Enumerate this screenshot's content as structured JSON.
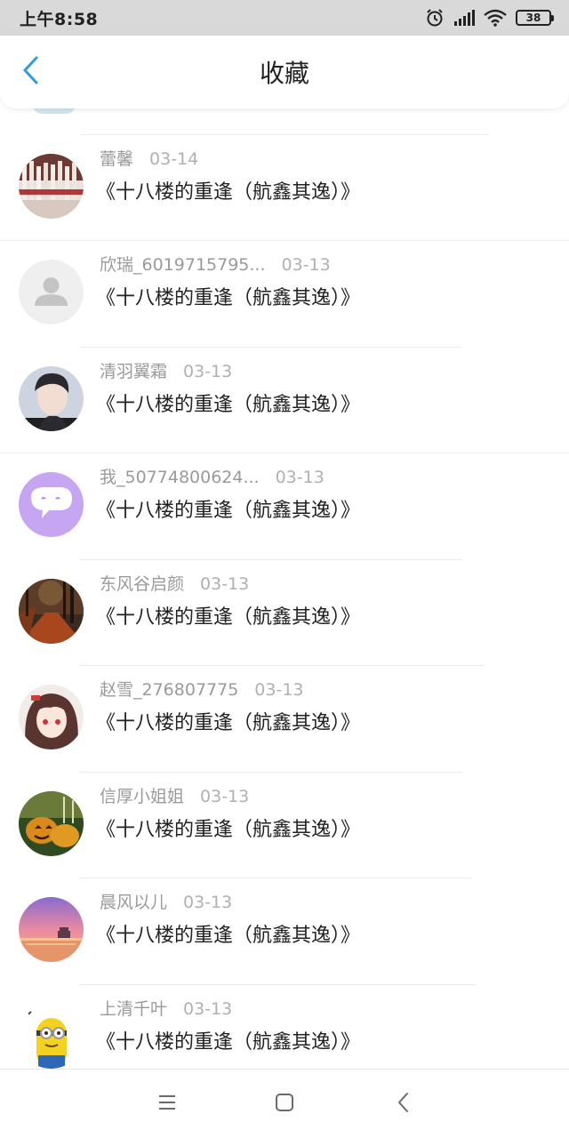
{
  "status_bar": {
    "time": "上午8:58",
    "battery": "38",
    "icons": [
      "alarm-icon",
      "signal-icon",
      "wifi-icon",
      "battery-icon"
    ]
  },
  "header": {
    "title": "收藏",
    "back_icon": "chevron-left-icon"
  },
  "colors": {
    "accent": "#2d9cdb",
    "text_primary": "#222222",
    "text_secondary": "#9a9a9a",
    "divider": "#ececec"
  },
  "items": [
    {
      "name": "蕾馨",
      "date": "03-14",
      "title": "《十八楼的重逢（航鑫其逸）》",
      "avatar": "avatar-bottles"
    },
    {
      "name": "欣瑞_6019715795...",
      "date": "03-13",
      "title": "《十八楼的重逢（航鑫其逸）》",
      "avatar": "avatar-default"
    },
    {
      "name": "清羽翼霜",
      "date": "03-13",
      "title": "《十八楼的重逢（航鑫其逸）》",
      "avatar": "avatar-boy"
    },
    {
      "name": "我_50774800624...",
      "date": "03-13",
      "title": "《十八楼的重逢（航鑫其逸）》",
      "avatar": "avatar-chat-bubble"
    },
    {
      "name": "东风谷启颜",
      "date": "03-13",
      "title": "《十八楼的重逢（航鑫其逸）》",
      "avatar": "avatar-autumn-road"
    },
    {
      "name": "赵雪_276807775",
      "date": "03-13",
      "title": "《十八楼的重逢（航鑫其逸）》",
      "avatar": "avatar-anime-girl"
    },
    {
      "name": "信厚小姐姐",
      "date": "03-13",
      "title": "《十八楼的重逢（航鑫其逸）》",
      "avatar": "avatar-pumpkins"
    },
    {
      "name": "晨风以儿",
      "date": "03-13",
      "title": "《十八楼的重逢（航鑫其逸）》",
      "avatar": "avatar-sunset"
    },
    {
      "name": "上清千叶",
      "date": "03-13",
      "title": "《十八楼的重逢（航鑫其逸）》",
      "avatar": "avatar-minion"
    }
  ],
  "nav_bar": {
    "icons": [
      "menu-icon",
      "home-square-icon",
      "back-triangle-icon"
    ]
  }
}
